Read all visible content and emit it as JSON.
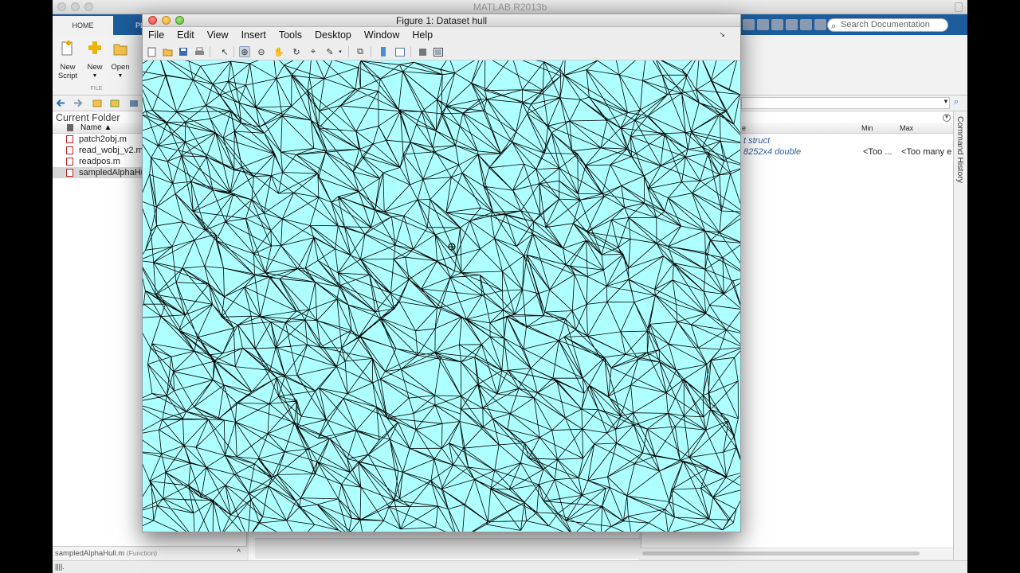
{
  "main_window": {
    "title": "MATLAB R2013b",
    "tabs": [
      "HOME",
      "PL"
    ],
    "ribbon_buttons": [
      {
        "label": "New\nScript",
        "icon": "new-script-icon"
      },
      {
        "label": "New",
        "icon": "new-icon"
      },
      {
        "label": "Open",
        "icon": "open-folder-icon"
      }
    ],
    "ribbon_group_label": "FILE",
    "search_placeholder": "Search Documentation"
  },
  "current_folder": {
    "title": "Current Folder",
    "column_name": "Name ▲",
    "files": [
      {
        "name": "patch2obj.m",
        "selected": false
      },
      {
        "name": "read_wobj_v2.m",
        "selected": false
      },
      {
        "name": "readpos.m",
        "selected": false
      },
      {
        "name": "sampledAlphaHull.m",
        "selected": true
      }
    ],
    "details_file": "sampledAlphaHull.m",
    "details_type": "(Function)"
  },
  "workspace": {
    "col_value": "e",
    "col_min": "Min",
    "col_max": "Max",
    "rows": [
      {
        "value": "t struct",
        "min": "",
        "max": ""
      },
      {
        "value": "8252x4 double",
        "min": "<Too ...",
        "max": "<Too many e"
      }
    ]
  },
  "command_history_label": "Command History",
  "status_text": "||||.",
  "figure": {
    "title": "Figure 1: Dataset hull",
    "menu": [
      "File",
      "Edit",
      "View",
      "Insert",
      "Tools",
      "Desktop",
      "Window",
      "Help"
    ],
    "canvas_color": "#aeffff",
    "edge_color": "#000000"
  }
}
